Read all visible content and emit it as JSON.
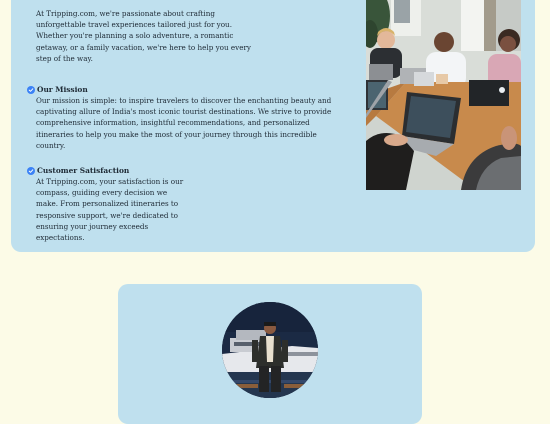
{
  "about": {
    "intro": "At Tripping.com, we're passionate about crafting unforgettable travel experiences tailored just for you. Whether you're planning a solo adventure, a romantic getaway, or a family vacation, we're here to help you every step of the way.",
    "mission": {
      "title": "Our Mission",
      "body": "Our mission is simple: to inspire travelers to discover the enchanting beauty and captivating allure of India's most iconic tourist destinations. We strive to provide comprehensive information, insightful recommendations, and personalized itineraries to help you make the most of your journey through this incredible country."
    },
    "satisfaction": {
      "title": "Customer Satisfaction",
      "body": "At Tripping.com, your satisfaction is our compass, guiding every decision we make. From personalized itineraries to responsive support, we're dedicated to ensuring your journey exceeds expectations."
    }
  },
  "colors": {
    "page_bg": "#fcfbe7",
    "card_bg": "#bfe0ee",
    "check": "#3b82f6"
  }
}
